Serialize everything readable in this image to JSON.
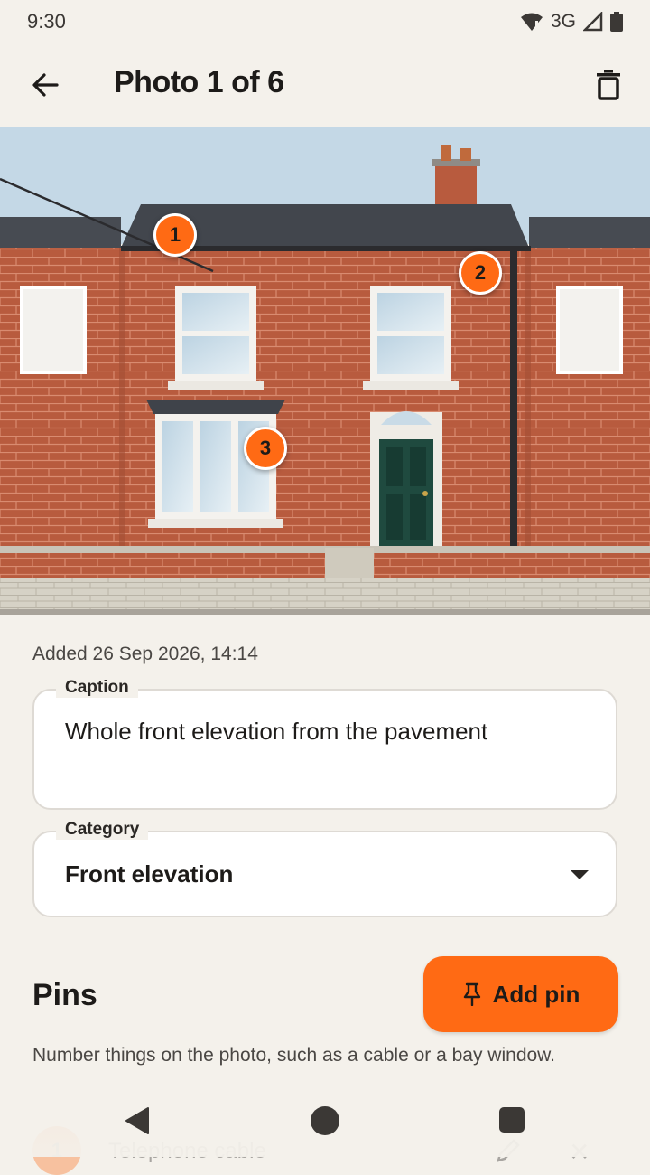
{
  "status_bar": {
    "time": "9:30",
    "network": "3G",
    "icons": [
      "wifi-alert-icon",
      "cellular-signal-icon",
      "battery-icon"
    ]
  },
  "app_bar": {
    "title": "Photo 1 of 6",
    "back_icon": "arrow-left-icon",
    "delete_icon": "trash-icon"
  },
  "photo": {
    "pins": [
      {
        "number": "1"
      },
      {
        "number": "2"
      },
      {
        "number": "3"
      }
    ]
  },
  "details": {
    "added": "Added 26 Sep 2026, 14:14",
    "caption_label": "Caption",
    "caption_value": "Whole front elevation from the pavement",
    "category_label": "Category",
    "category_value": "Front elevation"
  },
  "pins_section": {
    "heading": "Pins",
    "add_button_label": "Add pin",
    "add_button_icon": "pin-icon",
    "help_text": "Number things on the photo, such as a cable or a bay window.",
    "items": [
      {
        "number": "1",
        "label": "Telephone cable"
      }
    ]
  },
  "colors": {
    "accent": "#ff6a14",
    "background": "#f4f1eb",
    "surface": "#ffffff"
  }
}
